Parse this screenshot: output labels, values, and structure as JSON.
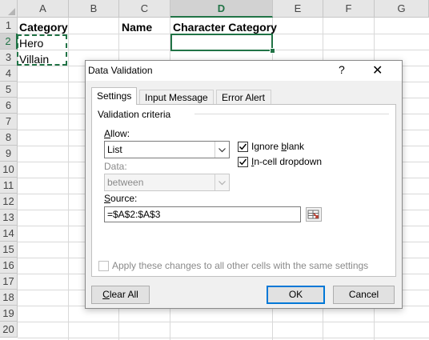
{
  "spreadsheet": {
    "columns": [
      "A",
      "B",
      "C",
      "D",
      "E",
      "F",
      "G"
    ],
    "selected_column": "D",
    "rows": [
      "1",
      "2",
      "3",
      "4",
      "5",
      "6",
      "7",
      "8",
      "9",
      "10",
      "11",
      "12",
      "13",
      "14",
      "15",
      "16",
      "17",
      "18",
      "19",
      "20"
    ],
    "selected_row": "2",
    "cells": {
      "A1": "Category",
      "A2": "Hero",
      "A3": "Villain",
      "C1": "Name",
      "D1": "Character Category"
    }
  },
  "dialog": {
    "title": "Data Validation",
    "help_glyph": "?",
    "close_glyph": "✕",
    "tabs": [
      "Settings",
      "Input Message",
      "Error Alert"
    ],
    "active_tab": "Settings",
    "group_label": "Validation criteria",
    "allow_label": "Allow:",
    "allow_value": "List",
    "ignore_blank_label": "Ignore blank",
    "ignore_blank_checked": true,
    "in_cell_dropdown_label": "In-cell dropdown",
    "in_cell_dropdown_checked": true,
    "data_label": "Data:",
    "data_value": "between",
    "source_label": "Source:",
    "source_value": "=$A$2:$A$3",
    "apply_all_label": "Apply these changes to all other cells with the same settings",
    "apply_all_checked": false,
    "clear_all_label": "Clear All",
    "ok_label": "OK",
    "cancel_label": "Cancel"
  },
  "colors": {
    "excel_green": "#217346",
    "focus_blue": "#0078d7"
  }
}
